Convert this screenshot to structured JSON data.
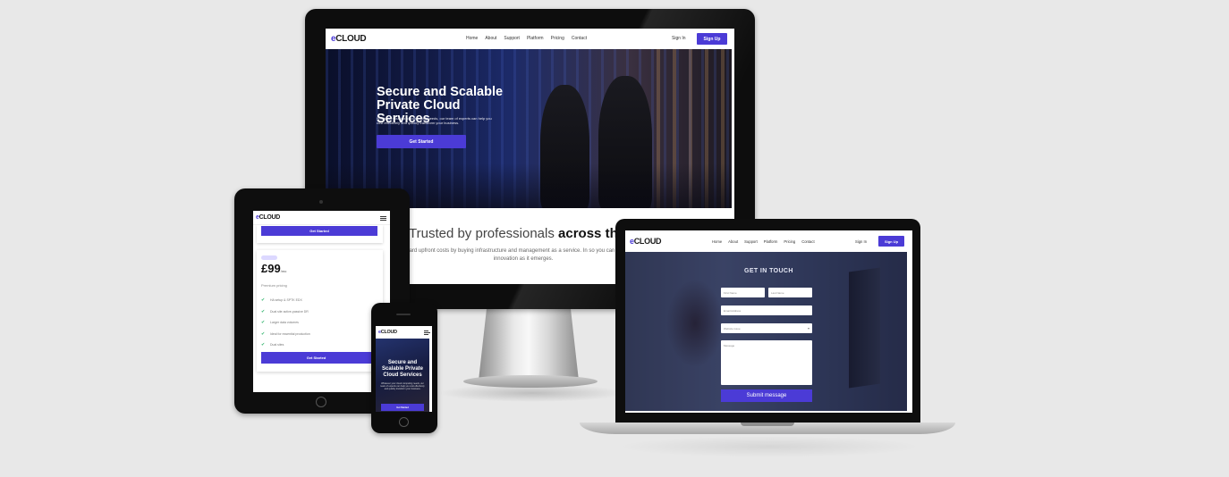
{
  "brand": {
    "logo_e": "e",
    "logo_rest": "CLOUD",
    "accent": "#4b3bd6",
    "background": "#e8e8e8"
  },
  "desktop": {
    "nav": {
      "links": [
        "Home",
        "About",
        "Support",
        "Platform",
        "Pricing",
        "Contact"
      ],
      "signin": "Sign In",
      "signup": "Sign Up"
    },
    "hero": {
      "title": "Secure and Scalable Private Cloud Services",
      "subtitle": "Whatever your cloud computing needs, our team of experts can help you cost effectively and quickly transform your business.",
      "cta": "Get Started"
    },
    "trusted": {
      "lead": "Trusted by professionals ",
      "bold": "across the w",
      "sub": "ard upfront costs by buying infrastructure and management as a service. In so you can embrace innovation as it emerges."
    }
  },
  "tablet": {
    "top_button": "Get Started",
    "badge": "",
    "price": "£99",
    "period": "/mo",
    "plan_desc": "Premium pricing",
    "features": [
      "HA setup & SPTK EDX",
      "Dual site active-passive DR",
      "Larger data volumes",
      "Ideal for essential production",
      "Dual sites"
    ],
    "bottom_button": "Get Started"
  },
  "phone": {
    "hero_title": "Secure and Scalable Private Cloud Services",
    "hero_sub": "Whatever your cloud computing needs, our team of experts can help you cost effectively and quickly transform your business.",
    "cta": "Get Started"
  },
  "laptop": {
    "nav": {
      "links": [
        "Home",
        "About",
        "Support",
        "Platform",
        "Pricing",
        "Contact"
      ],
      "signin": "Sign In",
      "signup": "Sign Up"
    },
    "form": {
      "title": "GET IN TOUCH",
      "first_name": "First Name",
      "last_name": "Last Name",
      "email": "Email Address",
      "select": "Website issue",
      "message": "Message",
      "submit": "Submit message"
    }
  }
}
